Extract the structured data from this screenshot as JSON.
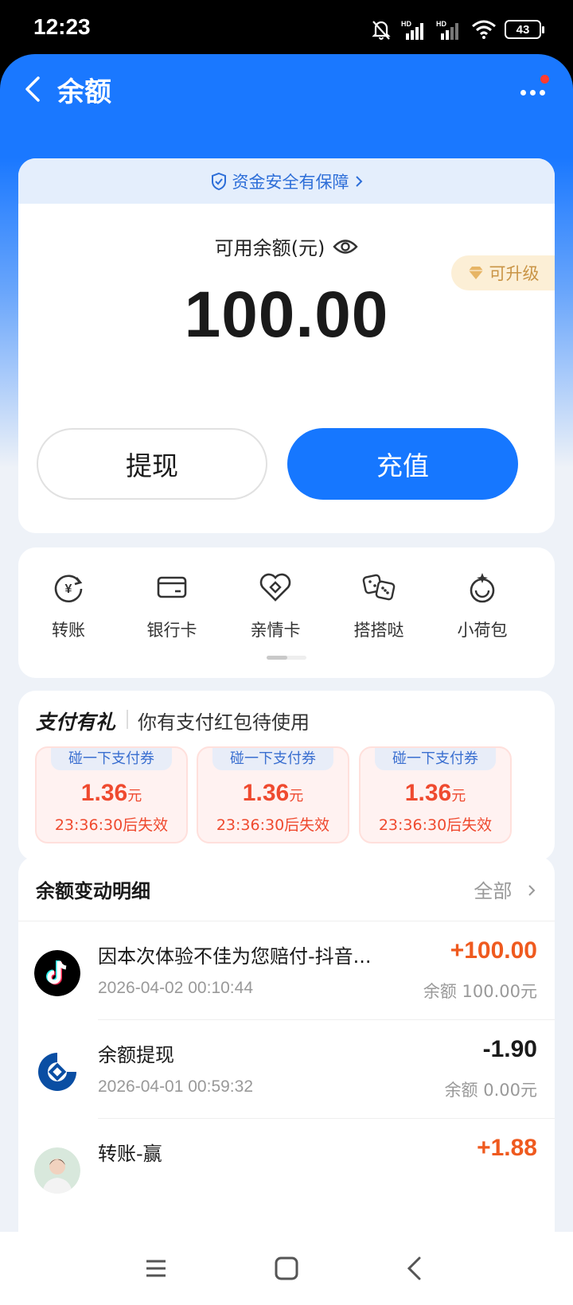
{
  "status_bar": {
    "time": "12:23",
    "battery": "43",
    "network_1": "HD",
    "network_2": "HD"
  },
  "header": {
    "title": "余额"
  },
  "balance_card": {
    "security_text": "资金安全有保障",
    "label": "可用余额(元)",
    "upgrade": "可升级",
    "amount": "100.00",
    "withdraw_label": "提现",
    "recharge_label": "充值"
  },
  "quick_actions": [
    {
      "label": "转账",
      "icon": "transfer-icon"
    },
    {
      "label": "银行卡",
      "icon": "bank-card-icon"
    },
    {
      "label": "亲情卡",
      "icon": "family-card-icon"
    },
    {
      "label": "搭搭哒",
      "icon": "dice-icon"
    },
    {
      "label": "小荷包",
      "icon": "wallet-pouch-icon"
    }
  ],
  "promo": {
    "title": "支付有礼",
    "subtitle": "你有支付红包待使用",
    "coupons": [
      {
        "tab": "碰一下支付券",
        "amount": "1.36",
        "unit": "元",
        "expire": "23:36:30后失效"
      },
      {
        "tab": "碰一下支付券",
        "amount": "1.36",
        "unit": "元",
        "expire": "23:36:30后失效"
      },
      {
        "tab": "碰一下支付券",
        "amount": "1.36",
        "unit": "元",
        "expire": "23:36:30后失效"
      }
    ]
  },
  "details": {
    "title": "余额变动明细",
    "filter": "全部",
    "transactions": [
      {
        "title": "因本次体验不佳为您赔付-抖音...",
        "time": "2026-04-02 00:10:44",
        "amount": "+100.00",
        "balance": "余额 100.00元",
        "color": "#ef5a1f"
      },
      {
        "title": "余额提现",
        "time": "2026-04-01 00:59:32",
        "amount": "-1.90",
        "balance": "余额 0.00元",
        "color": "#1a1a1a"
      },
      {
        "title": "转账-赢",
        "time": "",
        "amount": "+1.88",
        "balance": "",
        "color": "#ef5a1f"
      }
    ]
  },
  "colors": {
    "primary": "#1677ff",
    "accent_orange": "#ef5a1f",
    "coupon_red": "#ef4a2f"
  }
}
